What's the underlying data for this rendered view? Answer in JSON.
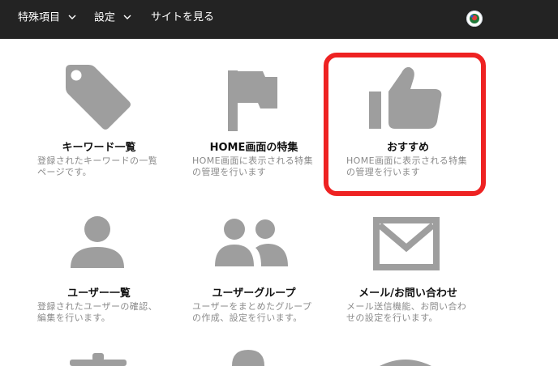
{
  "nav": {
    "special_items": "特殊項目",
    "settings": "設定",
    "view_site": "サイトを見る"
  },
  "cards": [
    {
      "title": "キーワード一覧",
      "desc": "登録されたキーワードの一覧ページです。"
    },
    {
      "title": "HOME画面の特集",
      "desc": "HOME画面に表示される特集の管理を行います"
    },
    {
      "title": "おすすめ",
      "desc": "HOME画面に表示される特集の管理を行います"
    },
    {
      "title": "ユーザー一覧",
      "desc": "登録されたユーザーの確認、編集を行います。"
    },
    {
      "title": "ユーザーグループ",
      "desc": "ユーザーをまとめたグループの作成、設定を行います。"
    },
    {
      "title": "メール/お問い合わせ",
      "desc": "メール送信機能、お問い合わせの設定を行います。"
    }
  ],
  "colors": {
    "topbar": "#232323",
    "icon_gray": "#9e9e9e",
    "highlight": "#ee2222"
  }
}
